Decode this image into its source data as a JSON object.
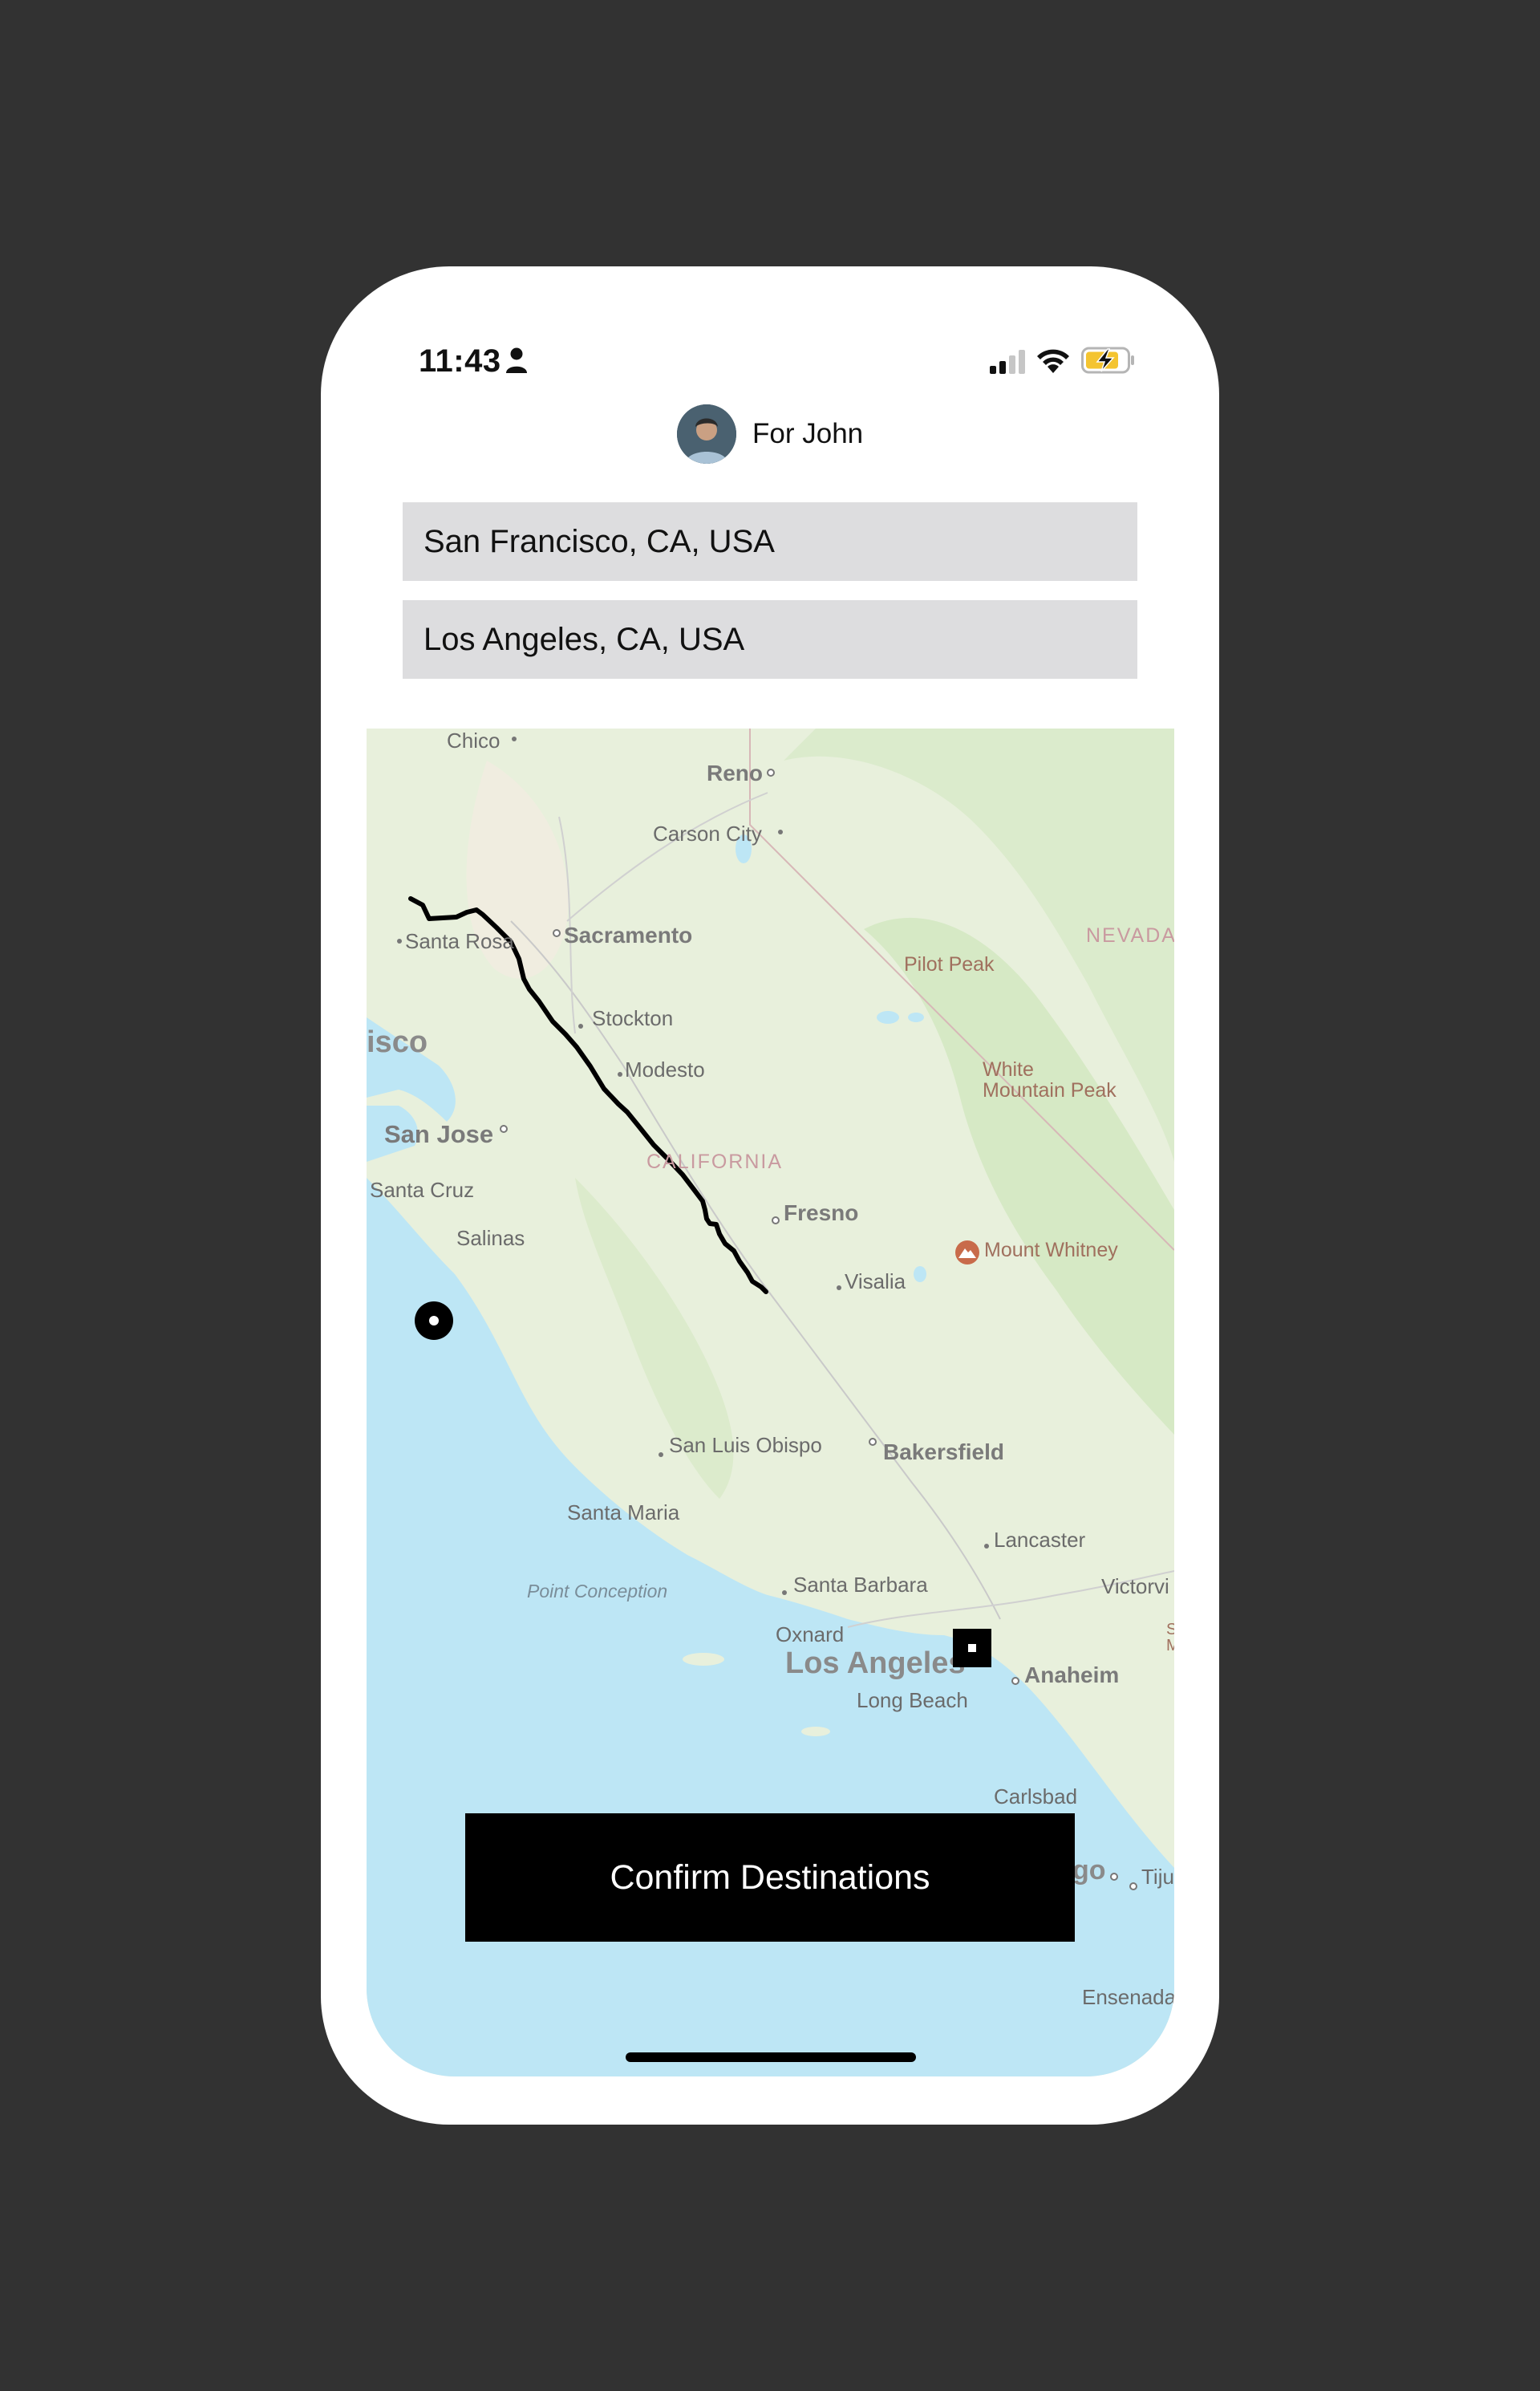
{
  "status_bar": {
    "time": "11:43",
    "icons": [
      "person-icon",
      "signal-icon",
      "wifi-icon",
      "battery-charging-icon"
    ]
  },
  "rider": {
    "label": "For John",
    "avatar": "avatar-photo"
  },
  "trip": {
    "origin_value": "San Francisco, CA, USA",
    "destination_value": "Los Angeles, CA, USA"
  },
  "map": {
    "labels": {
      "chico": "Chico",
      "reno": "Reno",
      "carson_city": "Carson City",
      "santa_rosa": "Santa Rosa",
      "sacramento": "Sacramento",
      "nevada": "NEVADA",
      "pilot_peak": "Pilot Peak",
      "stockton": "Stockton",
      "sf_partial": "isco",
      "modesto": "Modesto",
      "white_mountain_peak": "White\nMountain Peak",
      "san_jose": "San Jose",
      "california": "CALIFORNIA",
      "santa_cruz": "Santa Cruz",
      "fresno": "Fresno",
      "salinas": "Salinas",
      "mount_whitney": "Mount Whitney",
      "visalia": "Visalia",
      "san_luis_obispo": "San Luis Obispo",
      "bakersfield": "Bakersfield",
      "santa_maria": "Santa Maria",
      "lancaster": "Lancaster",
      "point_conception": "Point Conception",
      "santa_barbara": "Santa Barbara",
      "victorville": "Victorvi",
      "oxnard": "Oxnard",
      "los_angeles": "Los Angeles",
      "anaheim": "Anaheim",
      "long_beach": "Long Beach",
      "carlsbad": "Carlsbad",
      "san_diego_partial": "go",
      "tijuana_partial": "Tiju",
      "ensenada": "Ensenada",
      "edge_s": "S",
      "edge_m": "M"
    },
    "route": {
      "color": "#000000"
    },
    "colors": {
      "land": "#e8f0dc",
      "water": "#bde6f5",
      "park": "#d8ebc9"
    }
  },
  "actions": {
    "confirm_label": "Confirm Destinations"
  }
}
